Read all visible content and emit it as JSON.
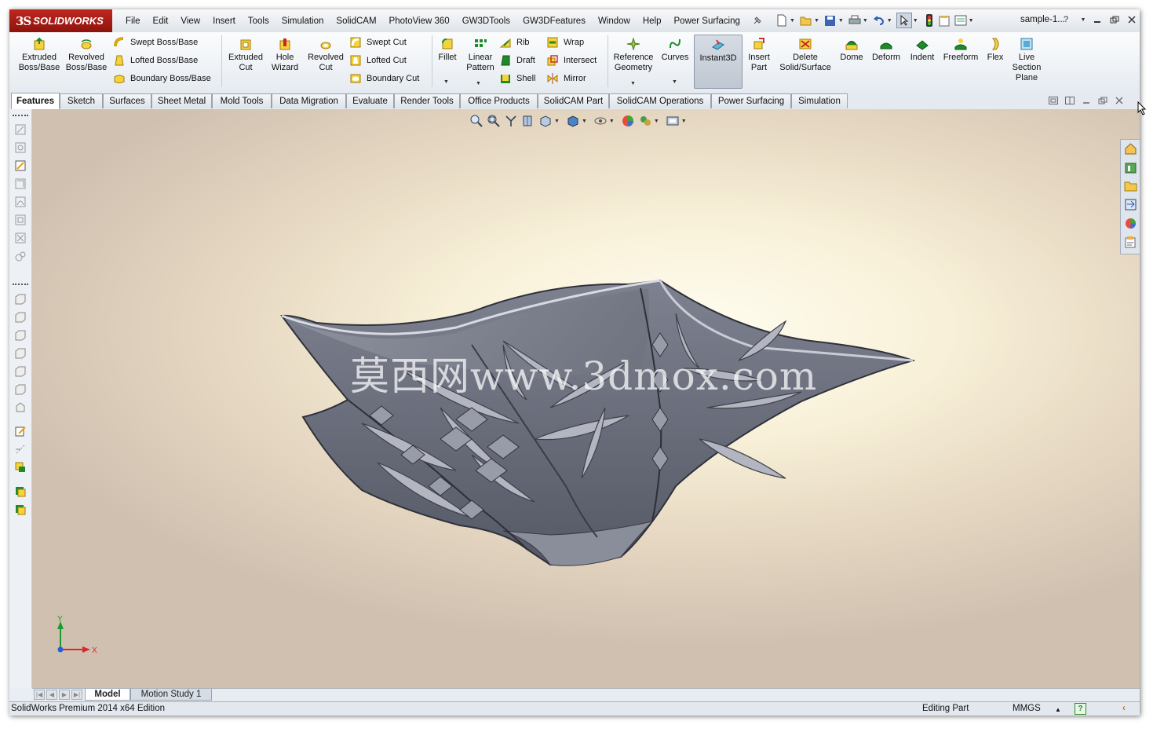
{
  "app": {
    "brand": "SOLIDWORKS",
    "brand_ds": "3S"
  },
  "menu": [
    "File",
    "Edit",
    "View",
    "Insert",
    "Tools",
    "Simulation",
    "SolidCAM",
    "PhotoView 360",
    "GW3DTools",
    "GW3DFeatures",
    "Window",
    "Help",
    "Power Surfacing"
  ],
  "document_title": "sample-1...",
  "commands": {
    "extruded_boss": [
      "Extruded",
      "Boss/Base"
    ],
    "revolved_boss": [
      "Revolved",
      "Boss/Base"
    ],
    "swept_boss": "Swept Boss/Base",
    "lofted_boss": "Lofted Boss/Base",
    "boundary_boss": "Boundary Boss/Base",
    "extruded_cut": [
      "Extruded",
      "Cut"
    ],
    "hole_wizard": [
      "Hole",
      "Wizard"
    ],
    "revolved_cut": [
      "Revolved",
      "Cut"
    ],
    "swept_cut": "Swept Cut",
    "lofted_cut": "Lofted Cut",
    "boundary_cut": "Boundary Cut",
    "fillet": "Fillet",
    "linear_pattern": [
      "Linear",
      "Pattern"
    ],
    "rib": "Rib",
    "draft": "Draft",
    "shell": "Shell",
    "wrap": "Wrap",
    "intersect": "Intersect",
    "mirror": "Mirror",
    "reference_geometry": [
      "Reference",
      "Geometry"
    ],
    "curves": "Curves",
    "instant3d": "Instant3D",
    "insert_part": [
      "Insert",
      "Part"
    ],
    "delete_solid": [
      "Delete",
      "Solid/Surface"
    ],
    "dome": "Dome",
    "deform": "Deform",
    "indent": "Indent",
    "freeform": "Freeform",
    "flex": "Flex",
    "live_section": [
      "Live",
      "Section",
      "Plane"
    ]
  },
  "tabs": [
    "Features",
    "Sketch",
    "Surfaces",
    "Sheet Metal",
    "Mold Tools",
    "Data Migration",
    "Evaluate",
    "Render Tools",
    "Office Products",
    "SolidCAM Part",
    "SolidCAM Operations",
    "Power Surfacing",
    "Simulation"
  ],
  "active_tab": "Features",
  "watermark": "莫西网www.3dmox.com",
  "triad": {
    "x": "X",
    "y": "Y"
  },
  "bottom_tabs": [
    "Model",
    "Motion Study 1"
  ],
  "status": {
    "edition": "SolidWorks Premium 2014 x64 Edition",
    "mode": "Editing Part",
    "units": "MMGS",
    "help_glyph": "?"
  },
  "colors": {
    "brand_red": "#b01e16",
    "model_gray": "#6b6e7a",
    "viewport_light": "#fffdf0",
    "viewport_dark": "#cfc0b0"
  }
}
